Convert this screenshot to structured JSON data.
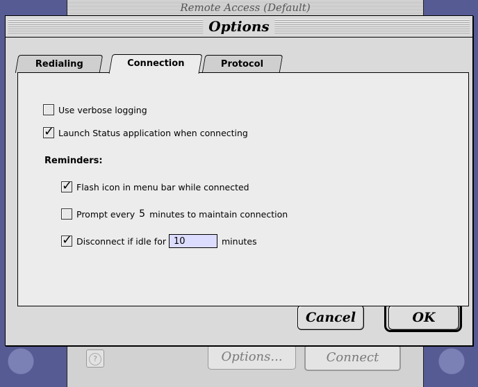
{
  "background_window": {
    "title": "Remote Access (Default)",
    "options_button": "Options...",
    "connect_button": "Connect",
    "help_label": "?"
  },
  "dialog": {
    "title": "Options",
    "tabs": [
      {
        "label": "Redialing",
        "active": false
      },
      {
        "label": "Connection",
        "active": true
      },
      {
        "label": "Protocol",
        "active": false
      }
    ],
    "options": {
      "verbose_logging": {
        "label": "Use verbose logging",
        "checked": false
      },
      "launch_status": {
        "label": "Launch Status application when connecting",
        "checked": true
      }
    },
    "reminders_heading": "Reminders:",
    "reminders": {
      "flash_icon": {
        "label": "Flash icon in menu bar while connected",
        "checked": true
      },
      "prompt": {
        "label_before": "Prompt every",
        "value": "5",
        "label_after": "minutes to maintain connection",
        "checked": false
      },
      "disconnect": {
        "label_before": "Disconnect if idle for",
        "value": "10",
        "label_after": "minutes",
        "checked": true
      }
    },
    "buttons": {
      "cancel": "Cancel",
      "ok": "OK"
    }
  },
  "colors": {
    "desktop": "#565b93",
    "panel": "#ececec",
    "field": "#dcdcff"
  }
}
